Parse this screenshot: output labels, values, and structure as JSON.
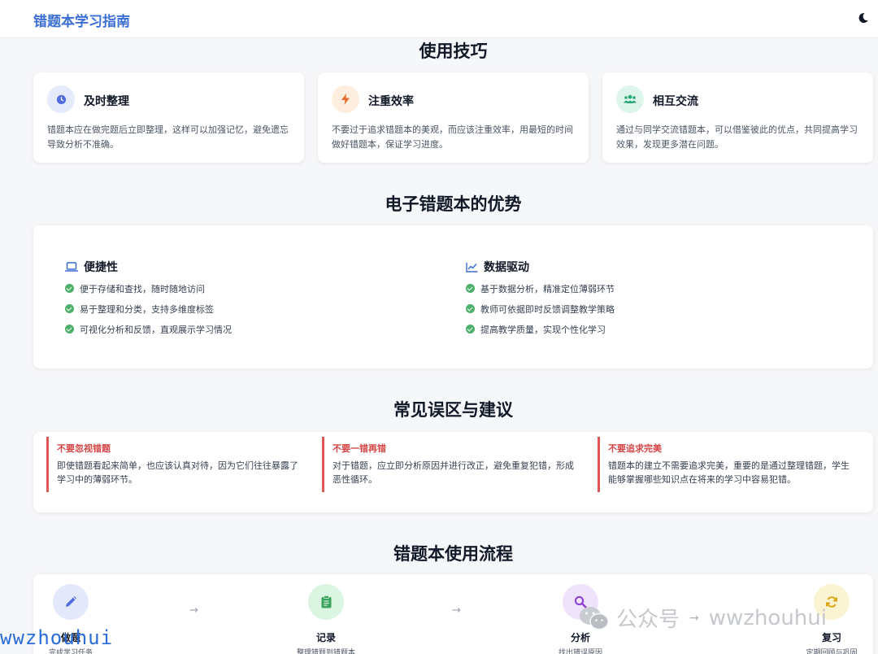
{
  "header": {
    "brand": "错题本学习指南",
    "theme_icon": "moon-icon"
  },
  "tips": {
    "title": "使用技巧",
    "cards": [
      {
        "title": "及时整理",
        "desc": "错题本应在做完题后立即整理，这样可以加强记忆，避免遗忘导致分析不准确。",
        "icon": "clock-icon",
        "color": "#4f6bde",
        "bg": "#e6ebfb"
      },
      {
        "title": "注重效率",
        "desc": "不要过于追求错题本的美观，而应该注重效率，用最短的时间做好错题本，保证学习进度。",
        "icon": "bolt-icon",
        "color": "#e86b2c",
        "bg": "#fdeedf"
      },
      {
        "title": "相互交流",
        "desc": "通过与同学交流错题本，可以借鉴彼此的优点，共同提高学习效果，发现更多潜在问题。",
        "icon": "users-icon",
        "color": "#2ba874",
        "bg": "#ddf5ea"
      }
    ]
  },
  "advantages": {
    "title": "电子错题本的优势",
    "columns": [
      {
        "heading": "便捷性",
        "icon": "laptop-icon",
        "items": [
          "便于存储和查找，随时随地访问",
          "易于整理和分类，支持多维度标签",
          "可视化分析和反馈，直观展示学习情况"
        ]
      },
      {
        "heading": "数据驱动",
        "icon": "chart-line-icon",
        "items": [
          "基于数据分析，精准定位薄弱环节",
          "教师可依据即时反馈调整教学策略",
          "提高教学质量，实现个性化学习"
        ]
      }
    ]
  },
  "mistakes": {
    "title": "常见误区与建议",
    "items": [
      {
        "title": "不要忽视错题",
        "desc": "即使错题看起来简单，也应该认真对待，因为它们往往暴露了学习中的薄弱环节。"
      },
      {
        "title": "不要一错再错",
        "desc": "对于错题，应立即分析原因并进行改正，避免重复犯错，形成恶性循环。"
      },
      {
        "title": "不要追求完美",
        "desc": "错题本的建立不需要追求完美，重要的是通过整理错题，学生能够掌握哪些知识点在将来的学习中容易犯错。"
      }
    ]
  },
  "process": {
    "title": "错题本使用流程",
    "steps": [
      {
        "title": "做题",
        "sub": "完成学习任务",
        "icon": "pencil-icon",
        "color": "#4f6bde",
        "bg": "#e3e9fb"
      },
      {
        "title": "记录",
        "sub": "整理错题到错题本",
        "icon": "clipboard-icon",
        "color": "#3aa55c",
        "bg": "#dcf4e2"
      },
      {
        "title": "分析",
        "sub": "找出错误原因",
        "icon": "search-icon",
        "color": "#8b3fd6",
        "bg": "#efe3fb"
      },
      {
        "title": "复习",
        "sub": "定期回顾与巩固",
        "icon": "refresh-icon",
        "color": "#d9a514",
        "bg": "#fbf4d2"
      }
    ],
    "arrow": "→"
  },
  "watermark": {
    "text": "公众号",
    "arrow": "→",
    "account": "wwzhouhui",
    "corner": "wwzhouhui"
  }
}
